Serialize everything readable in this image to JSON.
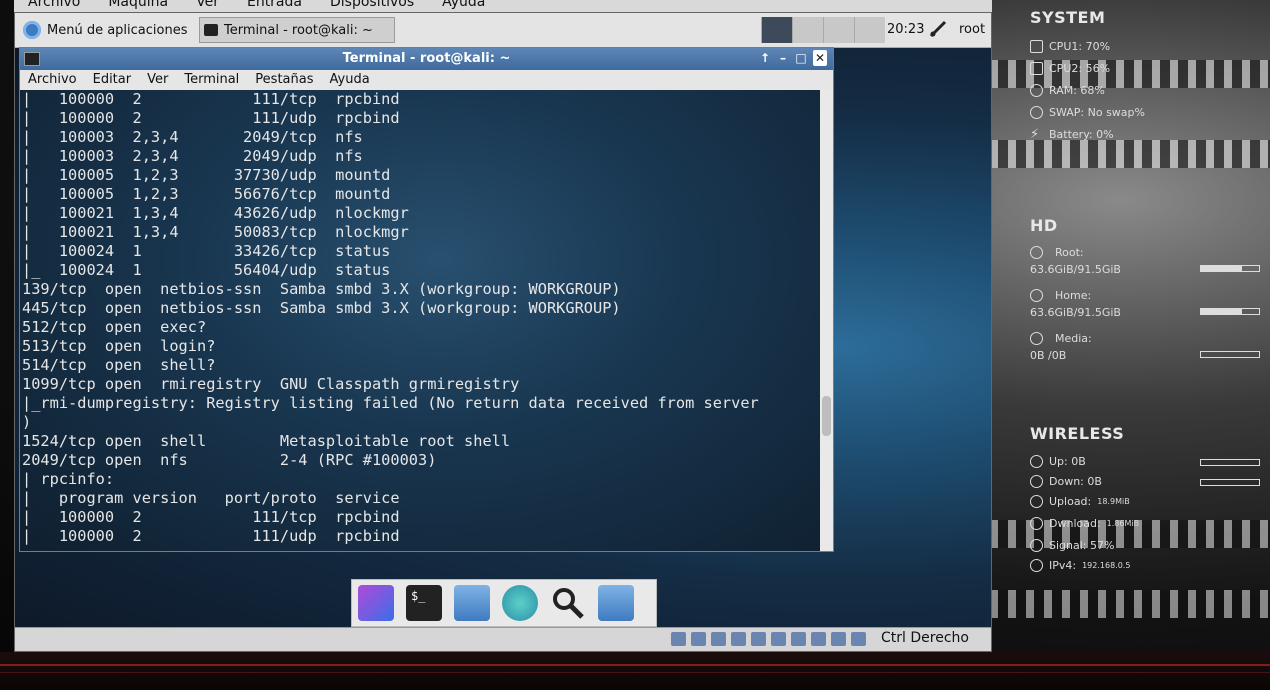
{
  "host": {
    "menubar": [
      "Archivo",
      "Maquina",
      "Ver",
      "Entrada",
      "Dispositivos",
      "Ayuda"
    ],
    "statusbar": {
      "host_key": "Ctrl Derecho"
    }
  },
  "guest_panel": {
    "apps_menu": "Menú de aplicaciones",
    "task_label": "Terminal - root@kali: ~",
    "clock": "20:23",
    "user": "root"
  },
  "terminal": {
    "title": "Terminal - root@kali: ~",
    "menu": [
      "Archivo",
      "Editar",
      "Ver",
      "Terminal",
      "Pestañas",
      "Ayuda"
    ],
    "output": "|   100000  2            111/tcp  rpcbind\n|   100000  2            111/udp  rpcbind\n|   100003  2,3,4       2049/tcp  nfs\n|   100003  2,3,4       2049/udp  nfs\n|   100005  1,2,3      37730/udp  mountd\n|   100005  1,2,3      56676/tcp  mountd\n|   100021  1,3,4      43626/udp  nlockmgr\n|   100021  1,3,4      50083/tcp  nlockmgr\n|   100024  1          33426/tcp  status\n|_  100024  1          56404/udp  status\n139/tcp  open  netbios-ssn  Samba smbd 3.X (workgroup: WORKGROUP)\n445/tcp  open  netbios-ssn  Samba smbd 3.X (workgroup: WORKGROUP)\n512/tcp  open  exec?\n513/tcp  open  login?\n514/tcp  open  shell?\n1099/tcp open  rmiregistry  GNU Classpath grmiregistry\n|_rmi-dumpregistry: Registry listing failed (No return data received from server\n)\n1524/tcp open  shell        Metasploitable root shell\n2049/tcp open  nfs          2-4 (RPC #100003)\n| rpcinfo:\n|   program version   port/proto  service\n|   100000  2            111/tcp  rpcbind\n|   100000  2            111/udp  rpcbind"
  },
  "conky": {
    "system_title": "SYSTEM",
    "cpu1": "CPU1: 70%",
    "cpu2": "CPU2: 56%",
    "ram": "RAM: 68%",
    "swap": "SWAP: No swap%",
    "battery": "Battery: 0%",
    "hd_title": "HD",
    "root_label": "Root:",
    "root_value": "63.6GiB/91.5GiB",
    "root_fraction": 0.7,
    "home_label": "Home:",
    "home_value": "63.6GiB/91.5GiB",
    "home_fraction": 0.7,
    "media_label": "Media:",
    "media_value": "0B  /0B",
    "media_fraction": 0,
    "wireless_title": "WIRELESS",
    "up": "Up: 0B",
    "down": "Down: 0B",
    "upload_label": "Upload:",
    "upload_value": "18.9MiB",
    "download_label": "Dwnload:",
    "download_value": "1.86MiB",
    "signal": "Signal: 57%",
    "ipv4_label": "IPv4:",
    "ipv4_value": "192.168.0.5"
  }
}
